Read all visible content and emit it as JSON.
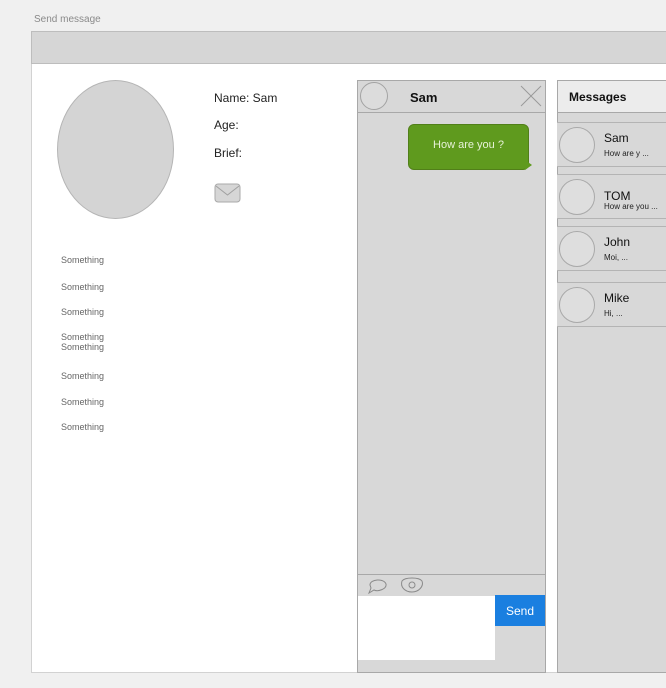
{
  "page_label": "Send message",
  "profile": {
    "name": "Name: Sam",
    "age": "Age:",
    "brief": "Brief:"
  },
  "sidebar": {
    "items": [
      "Something",
      "Something",
      "Something",
      "Something\nSomething",
      "Something",
      "Something",
      "Something"
    ]
  },
  "chat": {
    "title": "Sam",
    "messages": [
      {
        "text": "How are you ?",
        "color": "#5f9a1e"
      }
    ],
    "input": {
      "value": "",
      "placeholder": ""
    },
    "send_label": "Send",
    "send_color": "#1a7fe0"
  },
  "messages_panel": {
    "title": "Messages",
    "conversations": [
      {
        "name": "Sam",
        "preview": "How are y ..."
      },
      {
        "name": "TOM",
        "preview": "How are you ..."
      },
      {
        "name": "John",
        "preview": "Moi, ..."
      },
      {
        "name": "Mike",
        "preview": "Hi, ..."
      }
    ]
  }
}
